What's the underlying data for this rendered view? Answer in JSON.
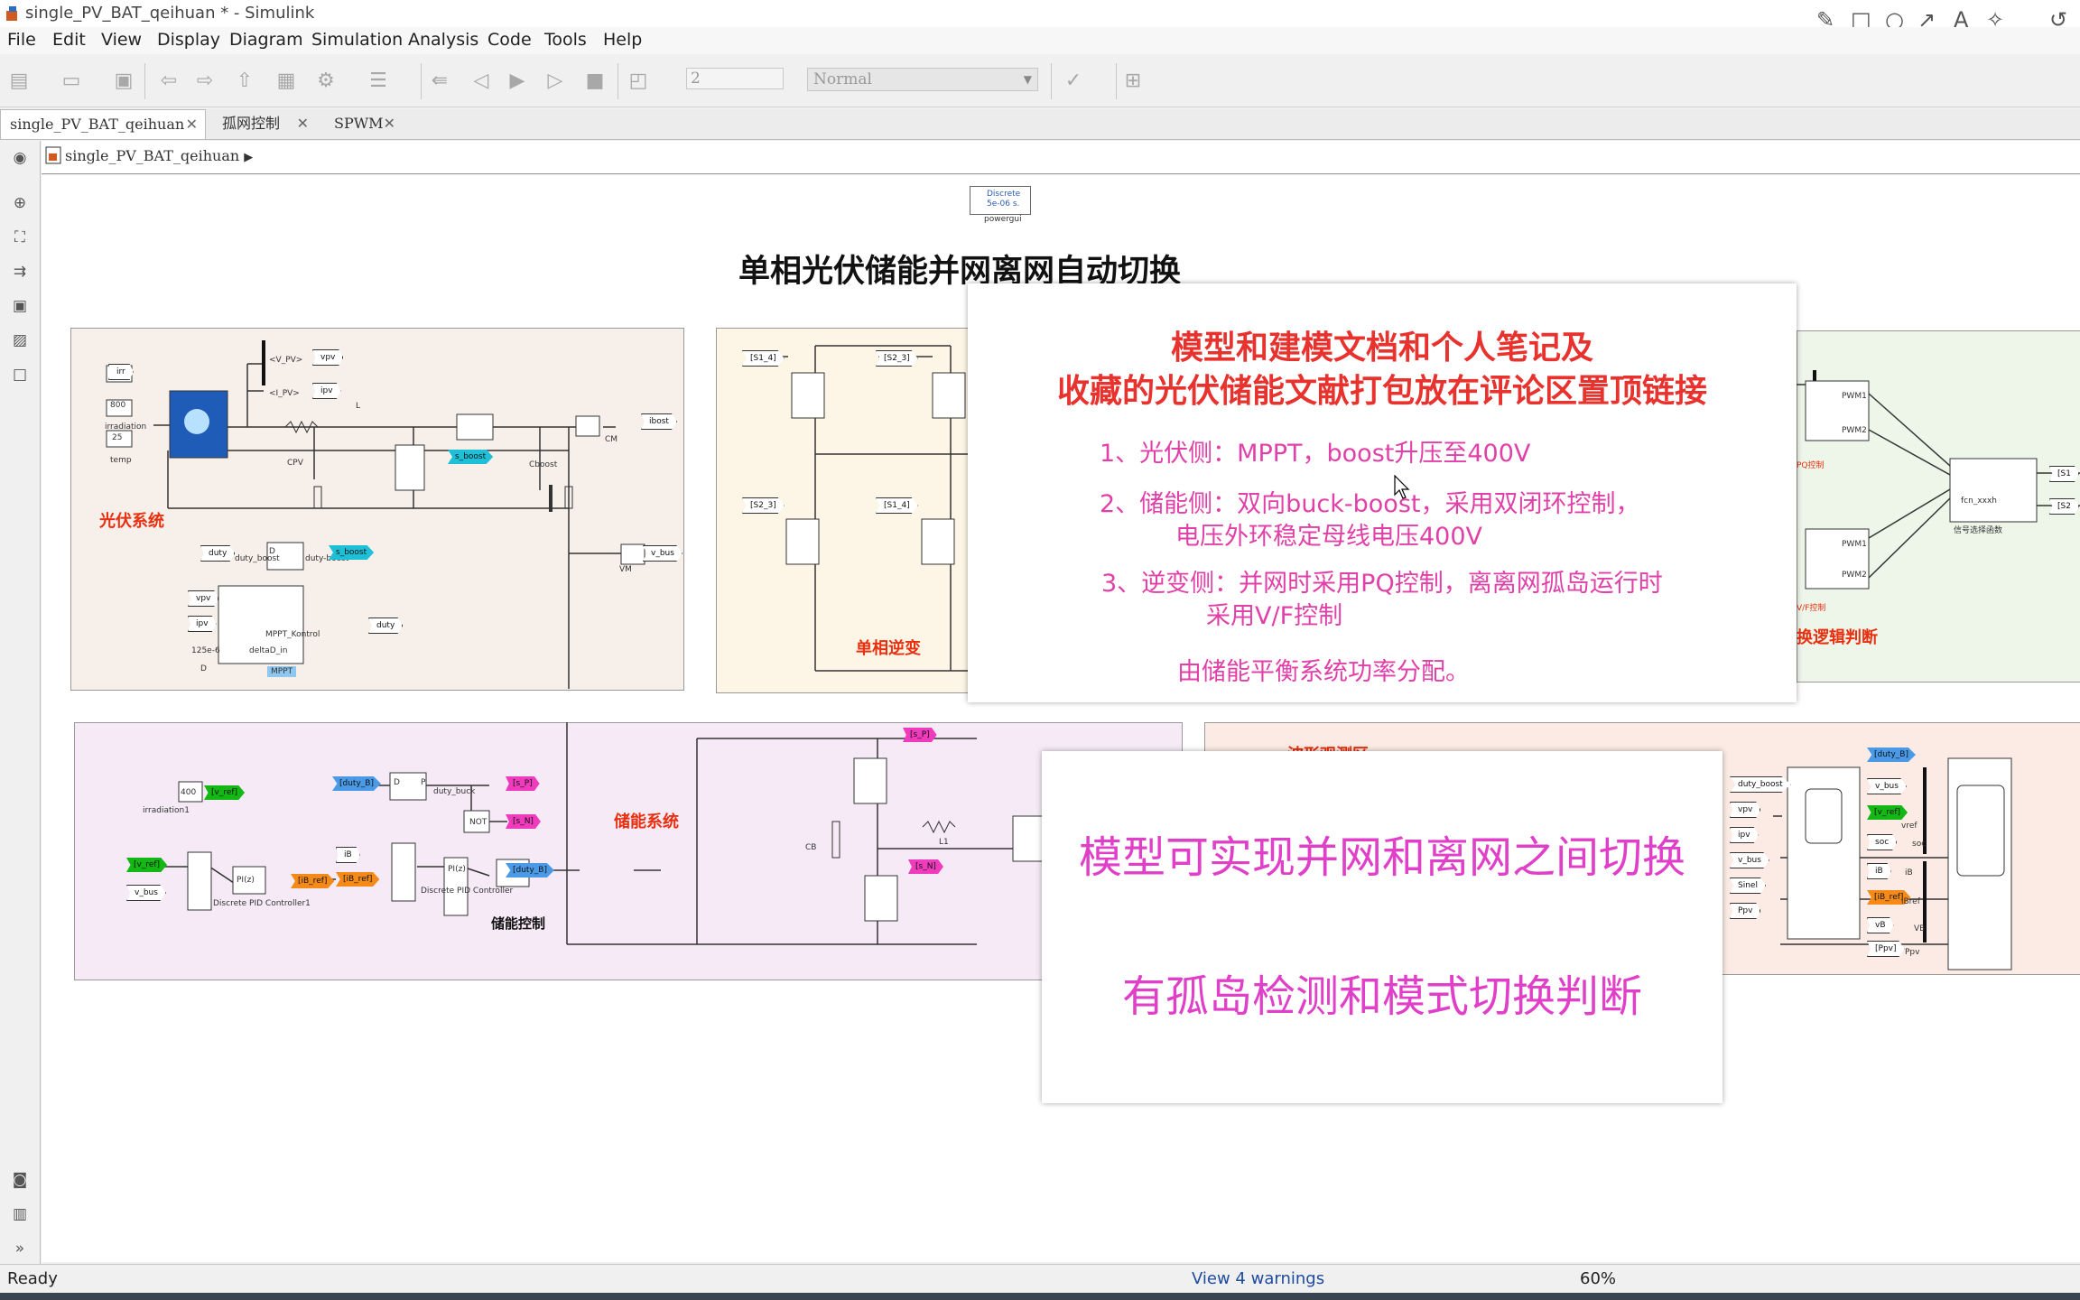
{
  "window": {
    "title": "single_PV_BAT_qeihuan * - Simulink"
  },
  "menu": [
    "File",
    "Edit",
    "View",
    "Display",
    "Diagram",
    "Simulation",
    "Analysis",
    "Code",
    "Tools",
    "Help"
  ],
  "toolbar": {
    "stop_time": "2",
    "sim_mode": "Normal"
  },
  "tabs": [
    {
      "label": "single_PV_BAT_qeihuan",
      "close": "✕"
    },
    {
      "label": "孤网控制",
      "close": "✕"
    },
    {
      "label": "SPWM",
      "close": "✕"
    }
  ],
  "breadcrumb": {
    "path": "single_PV_BAT_qeihuan",
    "arrow": "▶"
  },
  "diagram": {
    "title": "单相光伏储能并网离网自动切换",
    "powergui": {
      "line1": "Discrete",
      "line2": "5e-06 s.",
      "caption": "powergui"
    },
    "pv": {
      "label": "光伏系统",
      "tags": [
        "irr",
        "800",
        "25",
        "vpv",
        "ipv",
        "duty",
        "s_boost",
        "ibost",
        "v_bus",
        "125e-6",
        "duty"
      ],
      "captions": [
        "irradiation",
        "temp",
        "CPV",
        "Cboost",
        "CM",
        "VM",
        "MPPT_Kontrol",
        "MPPT",
        "L",
        "D",
        "deltaD_in",
        "duty_boost",
        "duty-boost",
        "<V_PV>",
        "<I_PV>"
      ]
    },
    "inverter": {
      "label": "单相逆变",
      "tags": [
        "[S1_4]",
        "[S2_3]",
        "[S2_3]",
        "[S1_4]"
      ]
    },
    "logic": {
      "label": "换逻辑判断",
      "captions": [
        "PWM1",
        "PWM2",
        "PWM1",
        "PWM2",
        "PQ控制",
        "V/F控制",
        "fcn_xxxh",
        "信号选择函数",
        "[S1",
        "[S2"
      ]
    },
    "storage": {
      "label": "储能系统",
      "control_label": "储能控制",
      "tags": [
        "400",
        "[v_ref]",
        "[duty_B]",
        "[s_P]",
        "[s_N]",
        "[v_ref]",
        "v_bus",
        "iB",
        "[iB_ref]",
        "[iB_ref]",
        "[duty_B]",
        "[s_P]",
        "[s_N]"
      ],
      "captions": [
        "irradiation1",
        "Discrete PID Controller1",
        "Discrete PID Controller",
        "NOT",
        "duty_buck",
        "CB",
        "L1",
        "PI(z)",
        "PI(z)",
        "D",
        "P"
      ]
    },
    "measure": {
      "label": "波形观测区",
      "tags": [
        "duty_boost",
        "vpv",
        "ipv",
        "v_bus",
        "Sinel",
        "Ppv",
        "[duty_B]",
        "v_bus",
        "[v_ref]",
        "soc",
        "iB",
        "[iB_ref]",
        "vB",
        "[Ppv]"
      ],
      "captions": [
        "vref",
        "soc",
        "iB",
        "iBref",
        "VB",
        "Ppv"
      ]
    }
  },
  "overlay_top": {
    "head1": "模型和建模文档和个人笔记及",
    "head2": "收藏的光伏储能文献打包放在评论区置顶链接",
    "line1": "1、光伏侧：MPPT，boost升压至400V",
    "line2a": "2、储能侧：双向buck-boost，采用双闭环控制，",
    "line2b": "电压外环稳定母线电压400V",
    "line3a": "3、逆变侧：并网时采用PQ控制，离离网孤岛运行时",
    "line3b": "采用V/F控制",
    "line4": "由储能平衡系统功率分配。"
  },
  "overlay_bottom": {
    "line1": "模型可实现并网和离网之间切换",
    "line2": "有孤岛检测和模式切换判断"
  },
  "status": {
    "ready": "Ready",
    "warnings": "View 4 warnings",
    "zoom": "60%"
  },
  "colors": {
    "pv_bg": "#f7efe9",
    "inverter_bg": "#fdf6e6",
    "logic_bg": "#eef6ea",
    "storage_bg": "#f6eaf7",
    "measure_bg": "#fbebe4",
    "tag_green": "#14b814",
    "tag_magenta": "#f03cbc",
    "tag_orange": "#f58a18",
    "tag_blue": "#4a9ae8",
    "tag_cyan": "#1ec0d8"
  }
}
